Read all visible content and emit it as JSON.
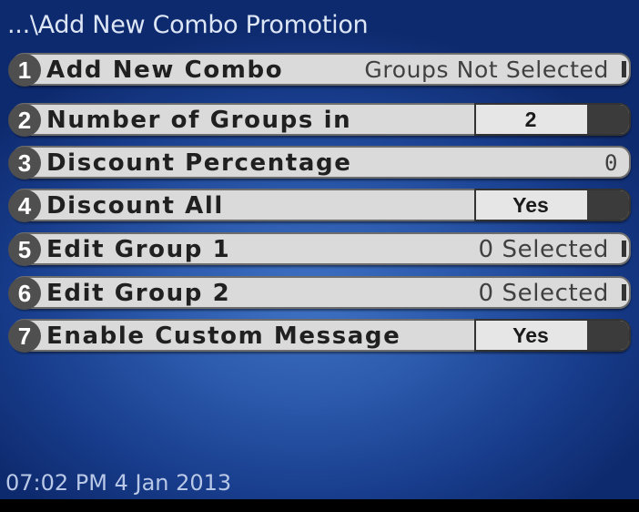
{
  "screen": {
    "title": "...\\Add New Combo Promotion",
    "status_text": "07:02 PM 4 Jan 2013"
  },
  "menu": {
    "items": [
      {
        "number": "1",
        "label": "Add New Combo",
        "value": "Groups Not Selected"
      },
      {
        "number": "2",
        "label": "Number of Groups in",
        "value": "2"
      },
      {
        "number": "3",
        "label": "Discount Percentage",
        "value": "0"
      },
      {
        "number": "4",
        "label": "Discount All",
        "value": "Yes"
      },
      {
        "number": "5",
        "label": "Edit Group 1",
        "value": "0 Selected"
      },
      {
        "number": "6",
        "label": "Edit Group 2",
        "value": "0 Selected"
      },
      {
        "number": "7",
        "label": "Enable Custom Message",
        "value": "Yes"
      }
    ]
  },
  "colors": {
    "background": "#2a57a9",
    "row_background": "#dadada",
    "number_badge": "#4f4f4f",
    "toggle_knob": "#3b3b3b"
  }
}
